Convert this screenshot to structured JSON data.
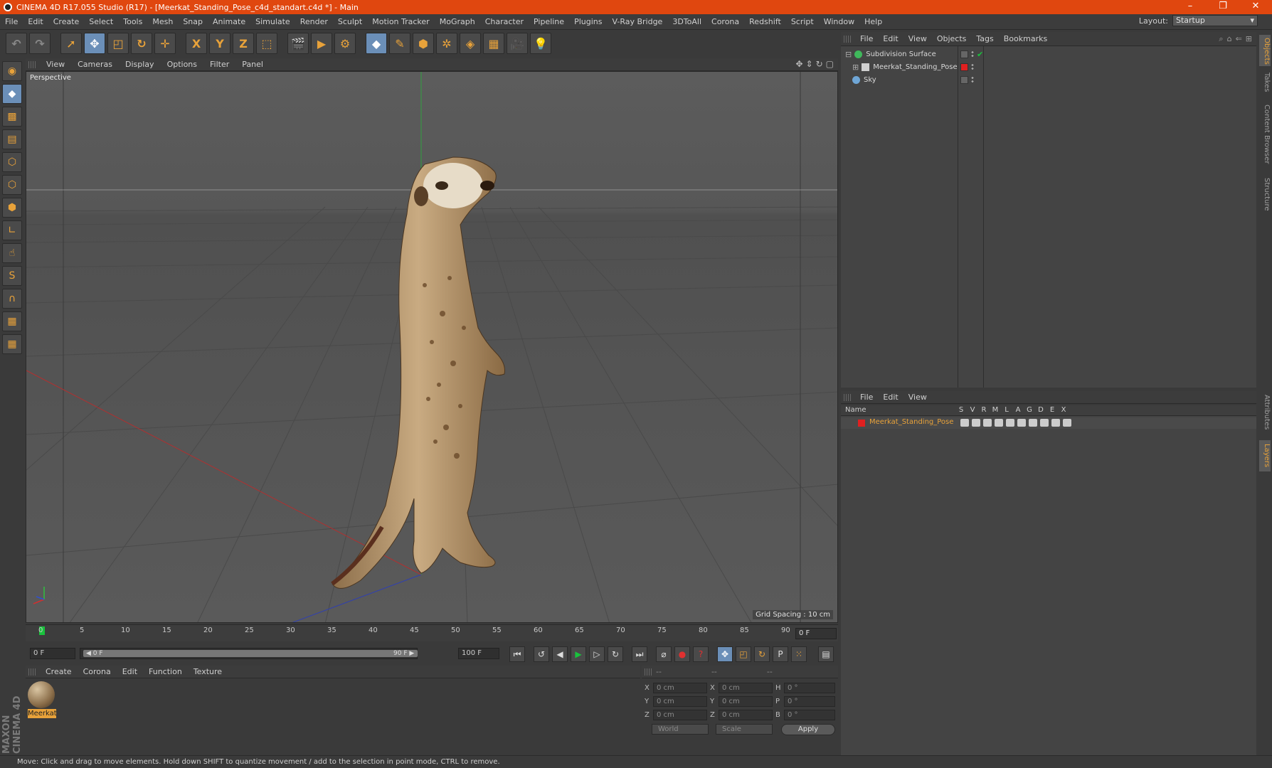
{
  "window": {
    "title": "CINEMA 4D R17.055 Studio (R17) - [Meerkat_Standing_Pose_c4d_standart.c4d *] - Main",
    "controls": [
      "–",
      "❐",
      "✕"
    ]
  },
  "menubar": {
    "items": [
      "File",
      "Edit",
      "Create",
      "Select",
      "Tools",
      "Mesh",
      "Snap",
      "Animate",
      "Simulate",
      "Render",
      "Sculpt",
      "Motion Tracker",
      "MoGraph",
      "Character",
      "Pipeline",
      "Plugins",
      "V-Ray Bridge",
      "3DToAll",
      "Corona",
      "Redshift",
      "Script",
      "Window",
      "Help"
    ],
    "layout_label": "Layout:",
    "layout_value": "Startup"
  },
  "toolbar": {
    "axis_x": "X",
    "axis_y": "Y",
    "axis_z": "Z"
  },
  "viewport": {
    "menu": [
      "View",
      "Cameras",
      "Display",
      "Options",
      "Filter",
      "Panel"
    ],
    "label": "Perspective",
    "grid_spacing": "Grid Spacing : 10 cm",
    "axis_y_label": "Y",
    "axis_x_label": "X",
    "axis_z_label": "Z"
  },
  "timeline": {
    "ticks": [
      "0",
      "5",
      "10",
      "15",
      "20",
      "25",
      "30",
      "35",
      "40",
      "45",
      "50",
      "55",
      "60",
      "65",
      "70",
      "75",
      "80",
      "85",
      "90"
    ],
    "current_frame": "0 F",
    "start_field": "0 F",
    "slider_start": "◀ 0 F",
    "slider_end": "90 F ▶",
    "end_field": "100 F"
  },
  "materials": {
    "menu": [
      "Create",
      "Corona",
      "Edit",
      "Function",
      "Texture"
    ],
    "items": [
      {
        "name": "Meerkat"
      }
    ]
  },
  "coordinates": {
    "headers": [
      "--",
      "--",
      "--"
    ],
    "rows": [
      {
        "a": "X",
        "av": "0 cm",
        "b": "X",
        "bv": "0 cm",
        "c": "H",
        "cv": "0 °"
      },
      {
        "a": "Y",
        "av": "0 cm",
        "b": "Y",
        "bv": "0 cm",
        "c": "P",
        "cv": "0 °"
      },
      {
        "a": "Z",
        "av": "0 cm",
        "b": "Z",
        "bv": "0 cm",
        "c": "B",
        "cv": "0 °"
      }
    ],
    "space": "World",
    "mode": "Scale",
    "apply": "Apply"
  },
  "object_manager": {
    "menu": [
      "File",
      "Edit",
      "View",
      "Objects",
      "Tags",
      "Bookmarks"
    ],
    "objects": [
      {
        "name": "Subdivision Surface",
        "icon_color": "#3fb85b"
      },
      {
        "name": "Meerkat_Standing_Pose",
        "icon_color": "#cfcfcf"
      },
      {
        "name": "Sky",
        "icon_color": "#6fa6d6"
      }
    ]
  },
  "layer_manager": {
    "menu": [
      "File",
      "Edit",
      "View"
    ],
    "columns": {
      "name": "Name",
      "flags": [
        "S",
        "V",
        "R",
        "M",
        "L",
        "A",
        "G",
        "D",
        "E",
        "X"
      ]
    },
    "layers": [
      {
        "name": "Meerkat_Standing_Pose",
        "color": "#e02020"
      }
    ]
  },
  "side_tabs": [
    "Objects",
    "Takes",
    "Content Browser",
    "Structure",
    "Attributes",
    "Layers"
  ],
  "status": "Move: Click and drag to move elements. Hold down SHIFT to quantize movement / add to the selection in point mode, CTRL to remove.",
  "brand": "MAXON CINEMA 4D",
  "colors": {
    "accent": "#e8a23a",
    "title_bar": "#e0470f",
    "play_green": "#19c23c"
  }
}
